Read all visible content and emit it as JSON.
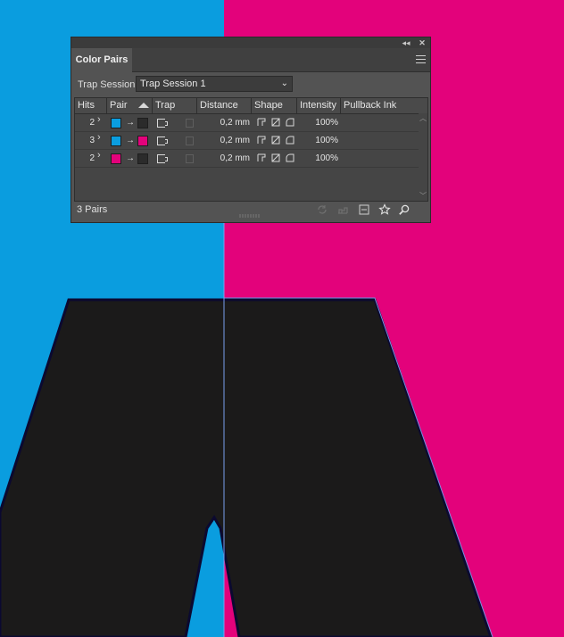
{
  "colors": {
    "cyan": "#0a9ddf",
    "magenta": "#e3027b",
    "black": "#1b1a1a",
    "panel_bg": "#535353"
  },
  "panel": {
    "tab_label": "Color Pairs",
    "collapse_icon": "double-chevron-left-icon",
    "close_icon": "close-icon",
    "menu_icon": "panel-menu-icon",
    "session_label": "Trap Session:",
    "session_value": "Trap Session 1",
    "columns": [
      "Hits",
      "Pair",
      "Trap",
      "Distance",
      "Shape",
      "Intensity",
      "Pullback Ink"
    ],
    "rows": [
      {
        "hits": "2",
        "from": "#0a9ddf",
        "to": "#2b2b2b",
        "distance": "0,2 mm",
        "intensity": "100%"
      },
      {
        "hits": "3",
        "from": "#0a9ddf",
        "to": "#e3027b",
        "distance": "0,2 mm",
        "intensity": "100%"
      },
      {
        "hits": "2",
        "from": "#e3027b",
        "to": "#2b2b2b",
        "distance": "0,2 mm",
        "intensity": "100%"
      }
    ],
    "pair_arrow": "→",
    "footer_count": "3 Pairs",
    "footer_icons": [
      "refresh-icon",
      "merge-icon",
      "remove-icon",
      "star-icon",
      "search-icon"
    ]
  }
}
